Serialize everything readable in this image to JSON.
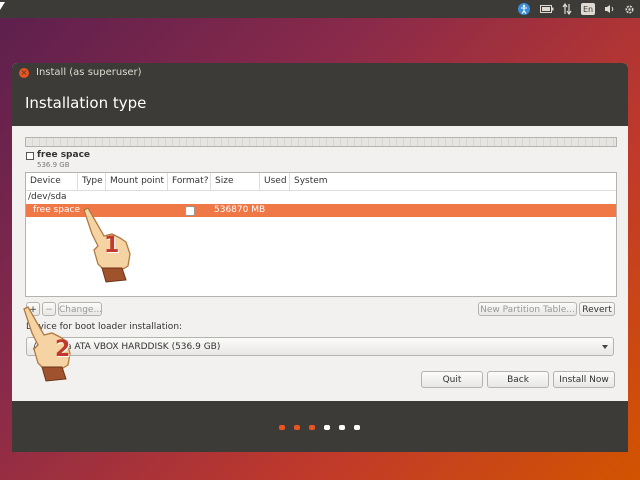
{
  "topbar": {
    "indicators": [
      {
        "icon": "accessibility-icon"
      },
      {
        "icon": "battery-icon"
      },
      {
        "icon": "network-icon"
      },
      {
        "label": "En"
      },
      {
        "icon": "sound-icon"
      },
      {
        "icon": "gear-icon"
      }
    ]
  },
  "window": {
    "title": "Install (as superuser)",
    "header": "Installation type"
  },
  "legend": {
    "name": "free space",
    "size": "536.9 GB"
  },
  "table": {
    "columns": [
      "Device",
      "Type",
      "Mount point",
      "Format?",
      "Size",
      "Used",
      "System"
    ],
    "device_row": "/dev/sda",
    "selected_row": {
      "device": "free space",
      "size": "536870 MB"
    }
  },
  "buttons": {
    "add": "+",
    "remove": "−",
    "change": "Change...",
    "new_table": "New Partition Table...",
    "revert": "Revert",
    "quit": "Quit",
    "back": "Back",
    "install": "Install Now"
  },
  "boot_loader": {
    "label": "Device for boot loader installation:",
    "value": "/dev/sda   ATA VBOX HARDDISK (536.9 GB)"
  },
  "annotations": {
    "step1": "1",
    "step2": "2"
  },
  "colors": {
    "accent": "#e95420",
    "selected_row": "#f07746",
    "panel": "#3c3b37"
  },
  "progress": {
    "total": 6,
    "completed": 3
  }
}
